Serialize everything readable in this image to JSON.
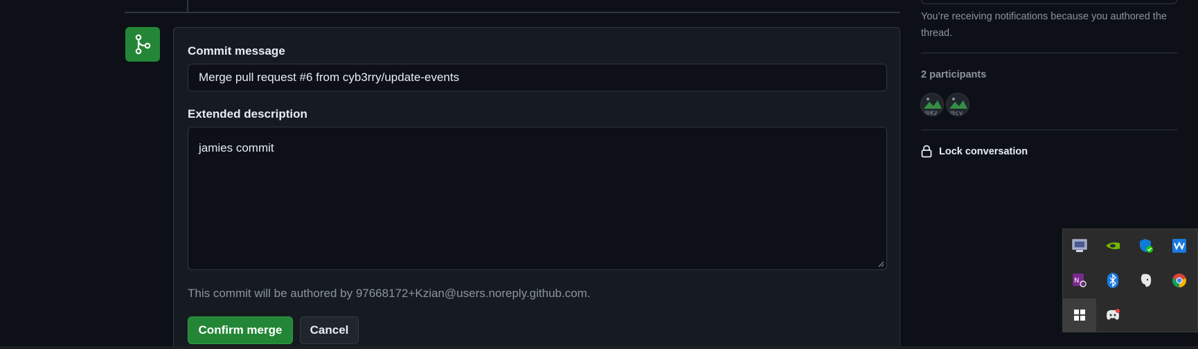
{
  "merge_form": {
    "commit_message_label": "Commit message",
    "commit_message_value": "Merge pull request #6 from cyb3rry/update-events",
    "extended_description_label": "Extended description",
    "extended_description_value": "jamies commit",
    "author_note": "This commit will be authored by 97668172+Kzian@users.noreply.github.com.",
    "confirm_label": "Confirm merge",
    "cancel_label": "Cancel",
    "icon": "git-merge-icon"
  },
  "sidebar": {
    "notification_text": "You’re receiving notifications because you authored the thread.",
    "participants_label": "2 participants",
    "participants": [
      {
        "alt": "@Kzian",
        "avatar_text": "@Kz"
      },
      {
        "alt": "@cyb3rry",
        "avatar_text": "@cy"
      }
    ],
    "lock_label": "Lock conversation",
    "lock_icon": "lock-icon"
  },
  "tray": {
    "icons": [
      "display-settings-icon",
      "nvidia-icon",
      "windows-security-icon",
      "waves-audio-icon",
      "snipping-tool-icon",
      "bluetooth-icon",
      "evernote-icon",
      "chrome-icon",
      "app-tile-icon",
      "discord-icon"
    ]
  },
  "colors": {
    "background": "#0d1117",
    "panel": "#161b22",
    "border": "#30363d",
    "accent_green": "#238636",
    "muted_text": "#8b949e"
  }
}
